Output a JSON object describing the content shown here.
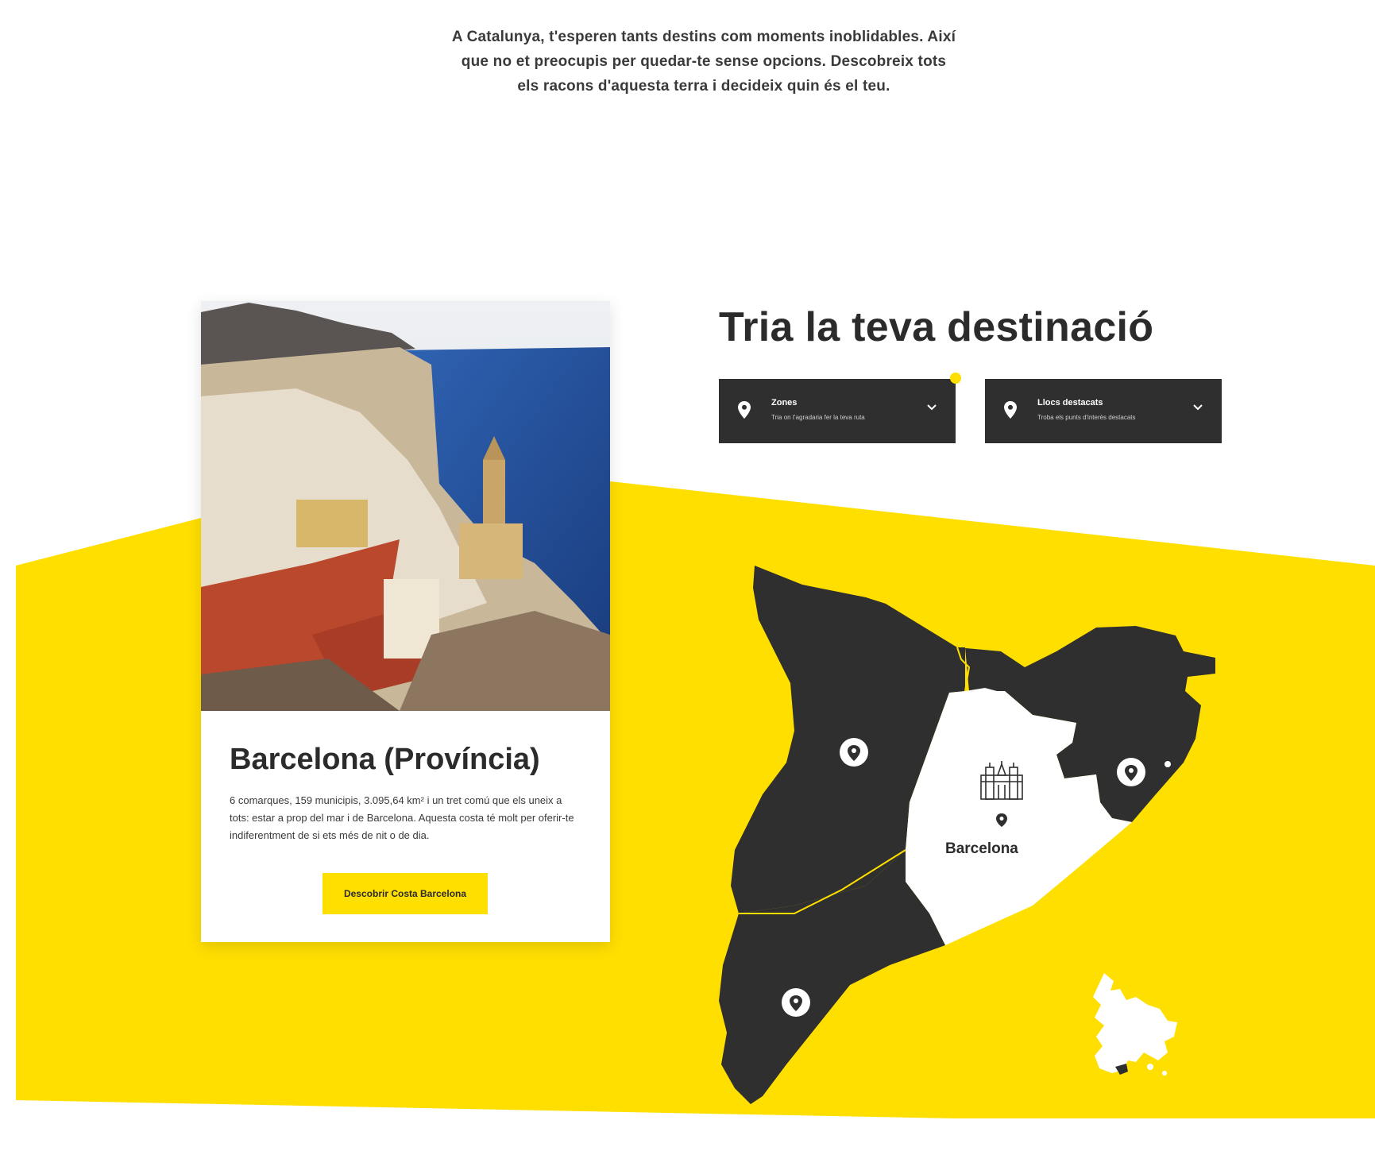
{
  "intro": {
    "text": "A Catalunya, t'esperen tants destins com moments inoblidables. Així que no et preocupis per quedar-te sense opcions. Descobreix tots els racons d'aquesta terra i decideix quin és el teu."
  },
  "card": {
    "title": "Barcelona (Província)",
    "description": "6 comarques, 159 municipis, 3.095,64 km² i un tret comú que els uneix a tots: estar a prop del mar i de Barcelona. Aquesta costa té molt per oferir-te indiferentment de si ets més de nit o de dia.",
    "button_label": "Descobrir Costa Barcelona"
  },
  "selector": {
    "heading": "Tria la teva destinació",
    "dropdowns": [
      {
        "label": "Zones",
        "sub": "Tria on t'agradaria fer la teva ruta",
        "icon": "map-pin-icon"
      },
      {
        "label": "Llocs destacats",
        "sub": "Troba els punts d'interès destacats",
        "icon": "map-pin-icon"
      }
    ]
  },
  "map": {
    "selected_region": "Barcelona",
    "icons": [
      "map-pin-icon",
      "cathedral-icon",
      "europe-locator-icon"
    ]
  },
  "colors": {
    "accent": "#ffdf00",
    "dark": "#2f2f2f",
    "selected_region": "#ffffff"
  }
}
